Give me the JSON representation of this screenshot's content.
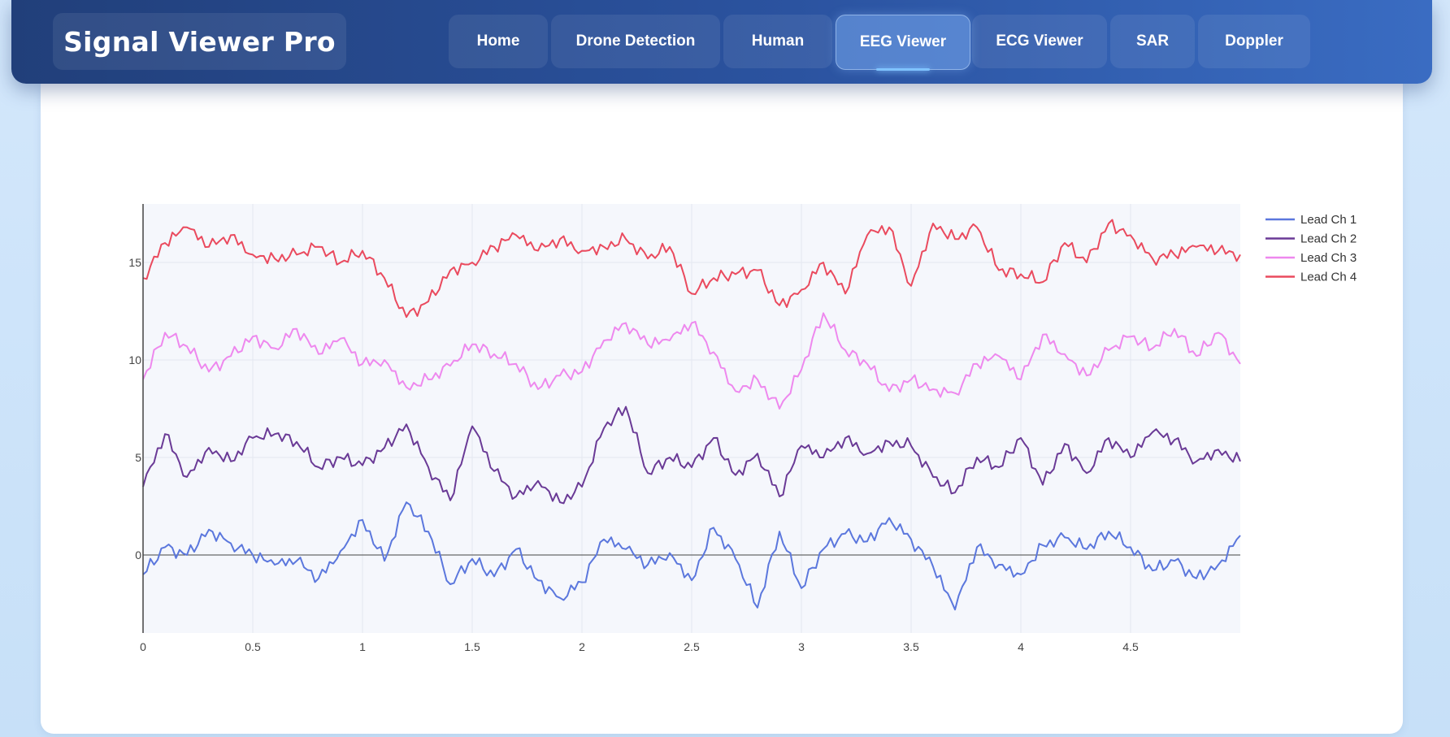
{
  "app": {
    "title": "Signal Viewer Pro"
  },
  "nav": {
    "items": [
      {
        "label": "Home",
        "active": false
      },
      {
        "label": "Drone Detection",
        "active": false
      },
      {
        "label": "Human",
        "active": false
      },
      {
        "label": "EEG Viewer",
        "active": true
      },
      {
        "label": "ECG Viewer",
        "active": false
      },
      {
        "label": "SAR",
        "active": false
      },
      {
        "label": "Doppler",
        "active": false
      }
    ]
  },
  "chart_data": {
    "type": "line",
    "title": "",
    "xlabel": "",
    "ylabel": "",
    "xlim": [
      0,
      5
    ],
    "ylim": [
      -4,
      18
    ],
    "xticks": [
      0,
      0.5,
      1,
      1.5,
      2,
      2.5,
      3,
      3.5,
      4,
      4.5
    ],
    "xtick_labels": [
      "0",
      "0.5",
      "1",
      "1.5",
      "2",
      "2.5",
      "3",
      "3.5",
      "4",
      "4.5"
    ],
    "yticks": [
      0,
      5,
      10,
      15
    ],
    "ytick_labels": [
      "0",
      "5",
      "10",
      "15"
    ],
    "grid": true,
    "legend_position": "top-right",
    "x": [
      0.0,
      0.1,
      0.2,
      0.3,
      0.4,
      0.5,
      0.6,
      0.7,
      0.8,
      0.9,
      1.0,
      1.1,
      1.2,
      1.3,
      1.4,
      1.5,
      1.6,
      1.7,
      1.8,
      1.9,
      2.0,
      2.1,
      2.2,
      2.3,
      2.4,
      2.5,
      2.6,
      2.7,
      2.8,
      2.9,
      3.0,
      3.1,
      3.2,
      3.3,
      3.4,
      3.5,
      3.6,
      3.7,
      3.8,
      3.9,
      4.0,
      4.1,
      4.2,
      4.3,
      4.4,
      4.5,
      4.6,
      4.7,
      4.8,
      4.9,
      5.0
    ],
    "series": [
      {
        "name": "Lead Ch 1",
        "color": "#5b77dd",
        "values": [
          -1.0,
          0.4,
          0.0,
          1.3,
          0.6,
          0.0,
          -0.5,
          -0.3,
          -1.2,
          0.2,
          1.8,
          -0.3,
          2.7,
          1.2,
          -1.5,
          -0.2,
          -1.1,
          0.3,
          -1.3,
          -2.2,
          -1.4,
          0.8,
          0.3,
          -0.5,
          0.1,
          -1.3,
          1.4,
          -0.2,
          -2.7,
          1.2,
          -1.7,
          0.3,
          1.1,
          0.7,
          1.9,
          0.8,
          -0.6,
          -2.8,
          0.4,
          -0.5,
          -1.0,
          0.5,
          0.9,
          0.3,
          1.2,
          0.4,
          -0.8,
          -0.3,
          -1.2,
          -0.5,
          1.0
        ]
      },
      {
        "name": "Lead Ch 2",
        "color": "#6a3a96",
        "values": [
          3.5,
          6.2,
          4.0,
          5.5,
          4.8,
          6.0,
          6.2,
          5.8,
          4.5,
          5.0,
          4.6,
          5.5,
          6.7,
          4.5,
          2.8,
          6.6,
          4.3,
          3.0,
          3.8,
          2.7,
          3.5,
          6.5,
          7.6,
          4.2,
          5.0,
          4.5,
          6.0,
          4.1,
          5.2,
          3.0,
          5.6,
          5.0,
          6.0,
          5.2,
          5.8,
          5.6,
          4.0,
          3.2,
          5.0,
          4.5,
          6.0,
          3.6,
          5.7,
          4.2,
          6.0,
          5.0,
          6.3,
          5.9,
          4.8,
          5.4,
          4.8
        ]
      },
      {
        "name": "Lead Ch 3",
        "color": "#ee88ee",
        "values": [
          9.0,
          11.4,
          10.7,
          9.4,
          10.2,
          11.2,
          10.6,
          11.6,
          10.3,
          11.1,
          9.8,
          10.0,
          8.6,
          9.0,
          9.7,
          10.8,
          10.3,
          9.8,
          8.5,
          9.2,
          9.4,
          11.0,
          11.9,
          10.8,
          11.0,
          11.9,
          10.4,
          8.4,
          9.0,
          7.5,
          9.5,
          12.4,
          10.5,
          9.8,
          8.4,
          9.0,
          8.5,
          8.3,
          9.8,
          10.2,
          9.0,
          11.3,
          10.3,
          9.2,
          10.5,
          11.2,
          10.6,
          11.6,
          10.2,
          11.4,
          9.8
        ]
      },
      {
        "name": "Lead Ch 4",
        "color": "#ea4a5e",
        "values": [
          14.2,
          16.0,
          16.8,
          15.8,
          16.4,
          15.4,
          15.2,
          15.4,
          15.8,
          15.0,
          15.6,
          14.2,
          12.2,
          13.0,
          14.6,
          15.0,
          15.8,
          16.4,
          15.6,
          16.2,
          15.6,
          15.8,
          16.2,
          15.2,
          15.8,
          13.4,
          14.2,
          14.4,
          14.6,
          12.8,
          13.6,
          15.0,
          13.4,
          16.4,
          16.8,
          13.8,
          17.0,
          16.2,
          16.8,
          14.6,
          14.4,
          14.0,
          16.0,
          15.0,
          17.0,
          16.4,
          15.2,
          15.4,
          15.8,
          15.6,
          15.4
        ]
      }
    ]
  }
}
